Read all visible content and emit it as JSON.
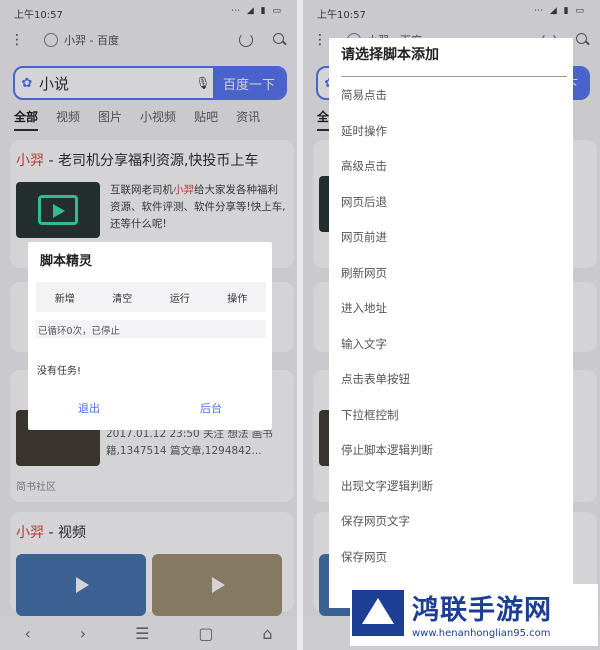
{
  "status": {
    "time": "上午10:57",
    "icons": "⋯ ◢ ▮ ▭"
  },
  "browser": {
    "tab_title": "小羿 - 百度",
    "search_query": "小说",
    "search_button": "百度一下"
  },
  "tabs": [
    "全部",
    "视频",
    "图片",
    "小视频",
    "贴吧",
    "资讯"
  ],
  "result1": {
    "title_hl": "小羿",
    "title_rest": " - 老司机分享福利资源,快投币上车",
    "desc_pre": "互联网老司机",
    "desc_hl": "小羿",
    "desc_post": "给大家发各种福利资源、软件评测、软件分享等!快上车,还等什么呢!"
  },
  "result3": {
    "meta": "2017.01.12 23:50 关注 想法 画书籍,1347514 篇文章,1294842...",
    "source": "简书社区"
  },
  "result4": {
    "title_hl": "小羿",
    "title_rest": " - 视频"
  },
  "dialog": {
    "title": "脚本精灵",
    "tabs": [
      "新增",
      "清空",
      "运行",
      "操作"
    ],
    "status": "已循环0次，已停止",
    "empty": "没有任务!",
    "btn_exit": "退出",
    "btn_background": "后台"
  },
  "menu": {
    "title": "请选择脚本添加",
    "items": [
      "简易点击",
      "延时操作",
      "高级点击",
      "网页后退",
      "网页前进",
      "刷新网页",
      "进入地址",
      "输入文字",
      "点击表单按钮",
      "下拉框控制",
      "停止脚本逻辑判断",
      "出现文字逻辑判断",
      "保存网页文字",
      "保存网页"
    ]
  },
  "watermark": {
    "name": "鸿联手游网",
    "url": "www.henanhonglian95.com"
  },
  "nav": {
    "back": "‹",
    "forward": "›",
    "menu": "☰",
    "tabs": "▢",
    "home": "⌂"
  }
}
